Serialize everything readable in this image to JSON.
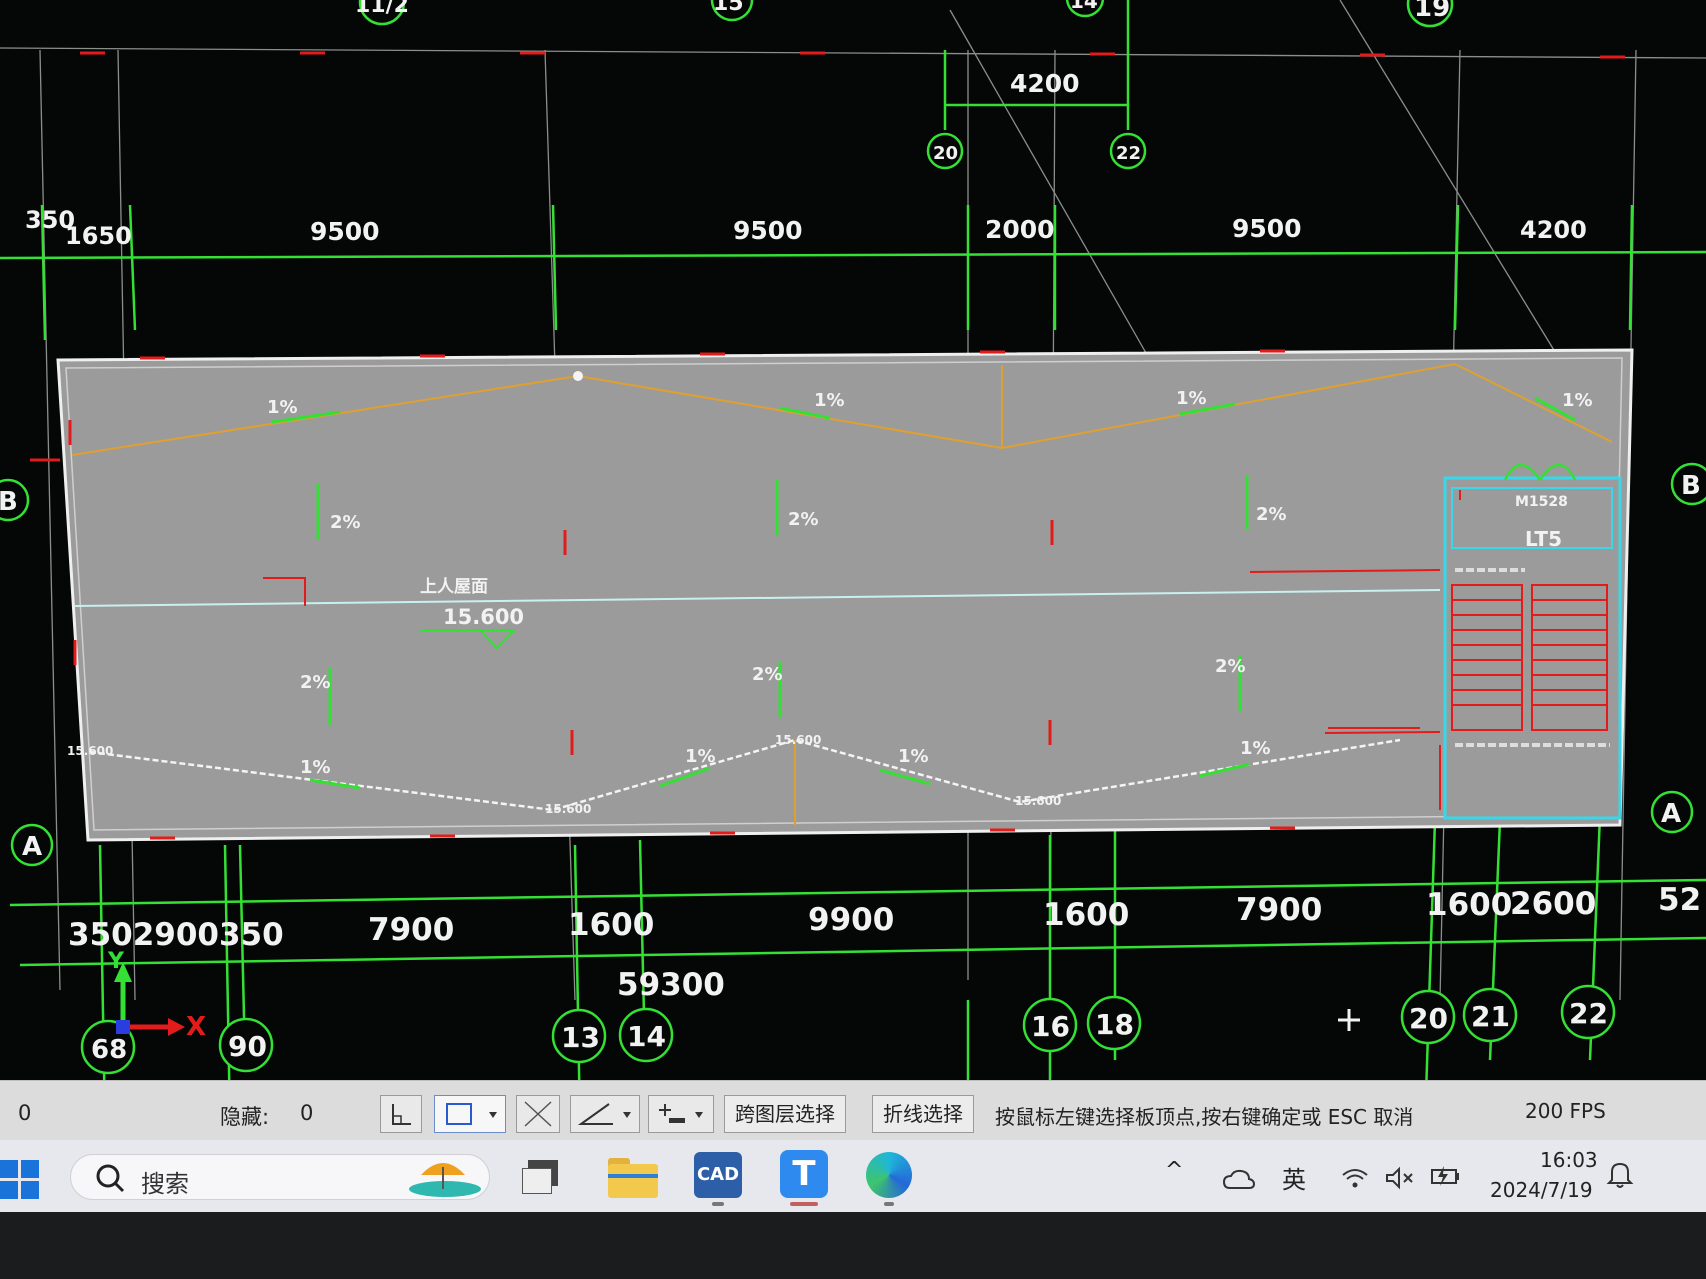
{
  "colors": {
    "background": "#050706",
    "plan": "#9a9a9a",
    "axis_green": "#35e035",
    "dim_text": "#f2f2f2",
    "slope_arrow": "#35e035",
    "red": "#e21b1b",
    "cyan": "#38d8ea",
    "orange": "#e0a030"
  },
  "top_dims": [
    "350",
    "1650",
    "9500",
    "9500",
    "2000",
    "9500",
    "4200"
  ],
  "top_inner_dim": "4200",
  "top_bubbles": [
    "20",
    "22"
  ],
  "top_partial_bubbles": [
    "11/2",
    "19",
    "15",
    "14"
  ],
  "bottom_dims": [
    "3502900350",
    "7900",
    "1600",
    "9900",
    "1600",
    "7900",
    "1600",
    "2600",
    "52"
  ],
  "bottom_total": "59300",
  "bottom_bubbles": [
    "68",
    "90",
    "13",
    "14",
    "16",
    "18",
    "20",
    "21",
    "22"
  ],
  "side_bubbles": {
    "left_b": "B",
    "left_a": "A",
    "right_b": "B",
    "right_a": "A"
  },
  "plan": {
    "slope_1pct": [
      "1%",
      "1%",
      "1%",
      "1%",
      "1%",
      "1%",
      "1%",
      "1%"
    ],
    "slope_2pct": [
      "2%",
      "2%",
      "2%",
      "2%",
      "2%",
      "2%"
    ],
    "elevation_main": "15.600",
    "elevation_small": [
      "15.600",
      "15.600",
      "15.600",
      "15.600"
    ],
    "stair_label": "LT5",
    "door_label": "M1528",
    "roof_label": "上人屋面"
  },
  "ucs": {
    "x": "X",
    "y": "Y"
  },
  "statusbar": {
    "count": "0",
    "hidden_label": "隐藏:",
    "hidden_value": "0",
    "btn_cross_layer": "跨图层选择",
    "btn_polyline": "折线选择",
    "prompt": "按鼠标左键选择板顶点,按右键确定或 ESC 取消",
    "fps": "200 FPS"
  },
  "taskbar": {
    "search_placeholder": "搜索",
    "cad_label": "CAD",
    "ime": "英",
    "time": "16:03",
    "date": "2024/7/19",
    "icons": [
      "windows-start-icon",
      "search-icon",
      "file-explorer-icon",
      "cad-app-icon",
      "t-app-icon",
      "edge-browser-icon"
    ]
  }
}
